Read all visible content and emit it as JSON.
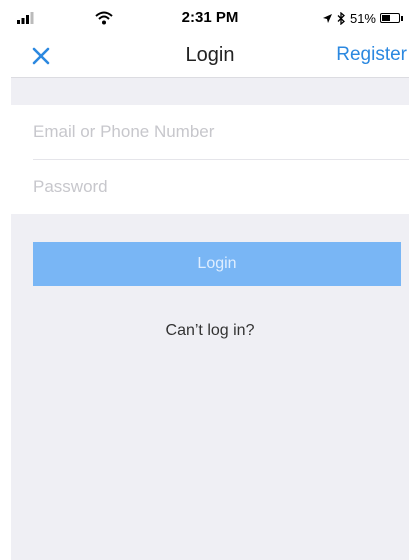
{
  "status_bar": {
    "time": "2:31 PM",
    "battery_text": "51%",
    "battery_level": 0.51,
    "icons": [
      "signal-icon",
      "wifi-icon",
      "location-icon",
      "bluetooth-icon",
      "battery-icon"
    ]
  },
  "nav": {
    "title": "Login",
    "register_label": "Register",
    "close_icon": "close-icon"
  },
  "form": {
    "email_placeholder": "Email or Phone Number",
    "email_value": "",
    "password_placeholder": "Password",
    "password_value": ""
  },
  "actions": {
    "login_label": "Login",
    "cant_login_label": "Can’t log in?"
  },
  "colors": {
    "accent": "#2b88e0",
    "login_button": "#79b6f5",
    "background": "#efeff4"
  }
}
